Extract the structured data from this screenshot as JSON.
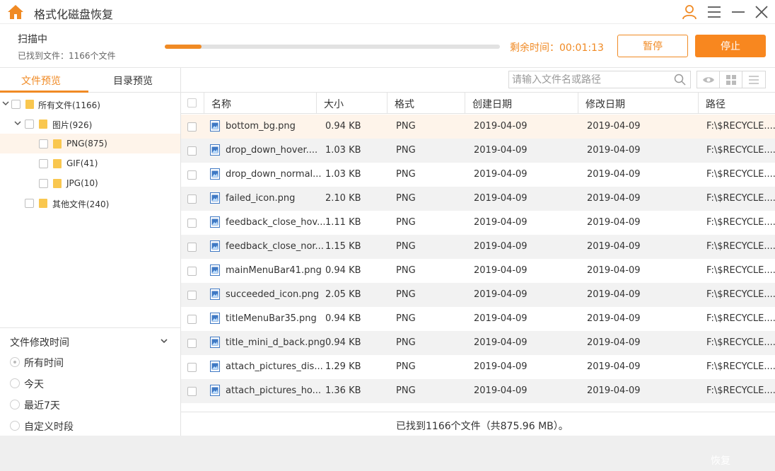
{
  "app": {
    "title": "格式化磁盘恢复"
  },
  "scan": {
    "title": "扫描中",
    "found": "已找到文件：1166个文件",
    "progress": 0.11,
    "remaining": "剩余时间：00:01:13",
    "pause_label": "暂停",
    "stop_label": "停止"
  },
  "left_tabs": {
    "file_preview": "文件预览",
    "dir_preview": "目录预览",
    "active": "file_preview"
  },
  "tree": [
    {
      "label": "所有文件(1166)"
    },
    {
      "label": "图片(926)"
    },
    {
      "label": "PNG(875)"
    },
    {
      "label": "GIF(41)"
    },
    {
      "label": "JPG(10)"
    },
    {
      "label": "其他文件(240)"
    }
  ],
  "filter": {
    "title": "文件修改时间",
    "options": [
      "所有时间",
      "今天",
      "最近7天",
      "自定义时段"
    ],
    "selected": "所有时间"
  },
  "search": {
    "placeholder": "请输入文件名或路径"
  },
  "table": {
    "headers": [
      "名称",
      "大小",
      "格式",
      "创建日期",
      "修改日期",
      "路径"
    ],
    "rows": [
      [
        "bottom_bg.png",
        "0.94 KB",
        "PNG",
        "2019-04-09",
        "2019-04-09",
        "F:\\$RECYCLE...."
      ],
      [
        "drop_down_hover....",
        "1.03 KB",
        "PNG",
        "2019-04-09",
        "2019-04-09",
        "F:\\$RECYCLE...."
      ],
      [
        "drop_down_normal...",
        "1.03 KB",
        "PNG",
        "2019-04-09",
        "2019-04-09",
        "F:\\$RECYCLE...."
      ],
      [
        "failed_icon.png",
        "2.10 KB",
        "PNG",
        "2019-04-09",
        "2019-04-09",
        "F:\\$RECYCLE...."
      ],
      [
        "feedback_close_hov...",
        "1.11 KB",
        "PNG",
        "2019-04-09",
        "2019-04-09",
        "F:\\$RECYCLE...."
      ],
      [
        "feedback_close_nor...",
        "1.15 KB",
        "PNG",
        "2019-04-09",
        "2019-04-09",
        "F:\\$RECYCLE...."
      ],
      [
        "mainMenuBar41.png",
        "0.94 KB",
        "PNG",
        "2019-04-09",
        "2019-04-09",
        "F:\\$RECYCLE...."
      ],
      [
        "succeeded_icon.png",
        "2.05 KB",
        "PNG",
        "2019-04-09",
        "2019-04-09",
        "F:\\$RECYCLE...."
      ],
      [
        "titleMenuBar35.png",
        "0.94 KB",
        "PNG",
        "2019-04-09",
        "2019-04-09",
        "F:\\$RECYCLE...."
      ],
      [
        "title_mini_d_back.png",
        "0.94 KB",
        "PNG",
        "2019-04-09",
        "2019-04-09",
        "F:\\$RECYCLE...."
      ],
      [
        "attach_pictures_dis...",
        "1.29 KB",
        "PNG",
        "2019-04-09",
        "2019-04-09",
        "F:\\$RECYCLE...."
      ],
      [
        "attach_pictures_ho...",
        "1.36 KB",
        "PNG",
        "2019-04-09",
        "2019-04-09",
        "F:\\$RECYCLE...."
      ]
    ]
  },
  "status": {
    "text": "已找到1166个文件（共875.96 MB）。"
  },
  "footer": {
    "recover_label": "恢复"
  },
  "colors": {
    "accent": "#f08a24",
    "selected_row": "#fef4ea",
    "alt_row": "#f2f2f2"
  }
}
